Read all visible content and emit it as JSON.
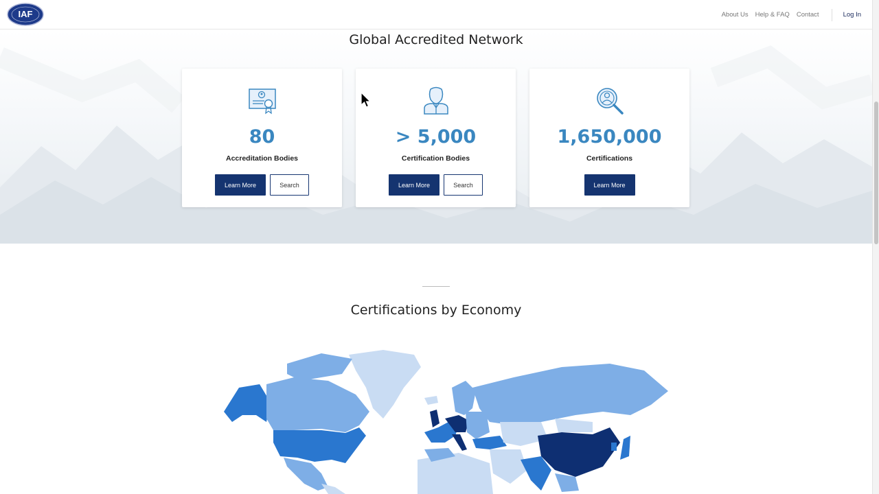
{
  "header": {
    "logo_text": "IAF",
    "nav": [
      "About Us",
      "Help & FAQ",
      "Contact"
    ],
    "login": "Log In"
  },
  "hero": {
    "title": "Global Accredited Network",
    "cards": [
      {
        "icon": "certificate-icon",
        "stat": "80",
        "label": "Accreditation Bodies",
        "learn_more": "Learn More",
        "search": "Search"
      },
      {
        "icon": "people-icon",
        "stat": "> 5,000",
        "label": "Certification Bodies",
        "learn_more": "Learn More",
        "search": "Search"
      },
      {
        "icon": "magnifier-person-icon",
        "stat": "1,650,000",
        "label": "Certifications",
        "learn_more": "Learn More"
      }
    ]
  },
  "economy": {
    "title": "Certifications by Economy"
  },
  "colors": {
    "primary": "#153470",
    "stat": "#3a87c0",
    "map_light": "#c9dcf3",
    "map_mid": "#7eaee6",
    "map_strong": "#2a77cf",
    "map_dark": "#0e2f72"
  }
}
